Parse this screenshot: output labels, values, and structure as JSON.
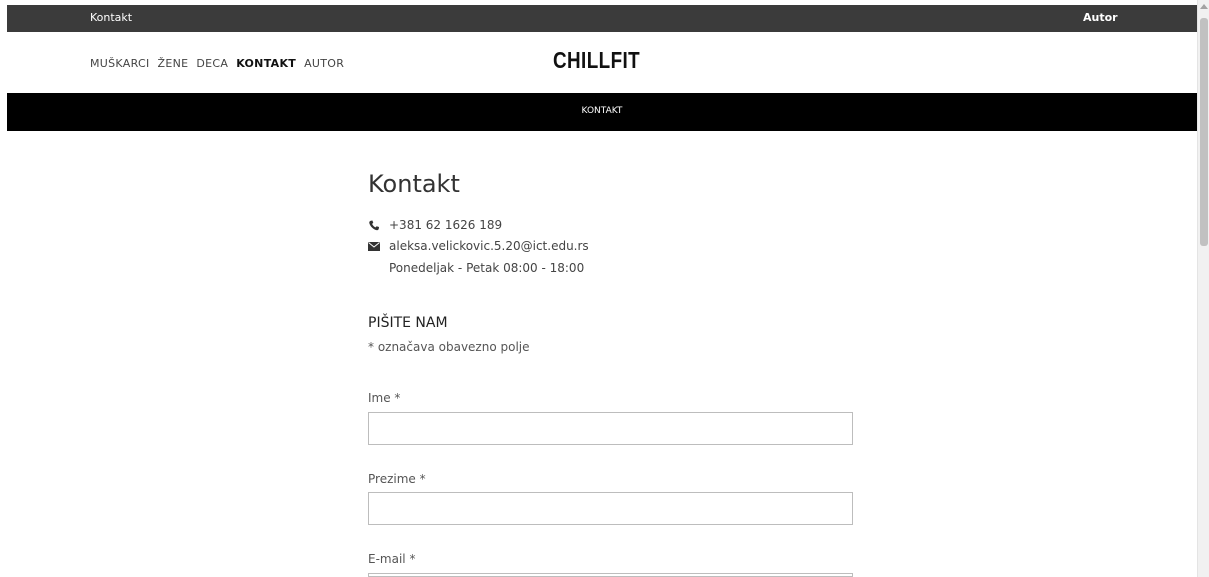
{
  "topbar": {
    "left_link": "Kontakt",
    "right_link": "Autor"
  },
  "nav": {
    "items": [
      "MUŠKARCI",
      "ŽENE",
      "DECA",
      "KONTAKT",
      "AUTOR"
    ],
    "active": "KONTAKT"
  },
  "logo": "CHILLFIT",
  "banner": {
    "label": "KONTAKT"
  },
  "page": {
    "title": "Kontakt",
    "phone": "+381 62 1626 189",
    "email": "aleksa.velickovic.5.20@ict.edu.rs",
    "hours": "Ponedeljak - Petak 08:00 - 18:00"
  },
  "form": {
    "title": "PIŠITE NAM",
    "note": "* označava obavezno polje",
    "fields": [
      {
        "label": "Ime *",
        "value": ""
      },
      {
        "label": "Prezime *",
        "value": ""
      },
      {
        "label": "E-mail *",
        "value": ""
      }
    ]
  },
  "icons": {
    "phone": "phone-icon",
    "email": "envelope-icon"
  },
  "colors": {
    "topbar": "#3b3b3b",
    "banner": "#000000"
  }
}
